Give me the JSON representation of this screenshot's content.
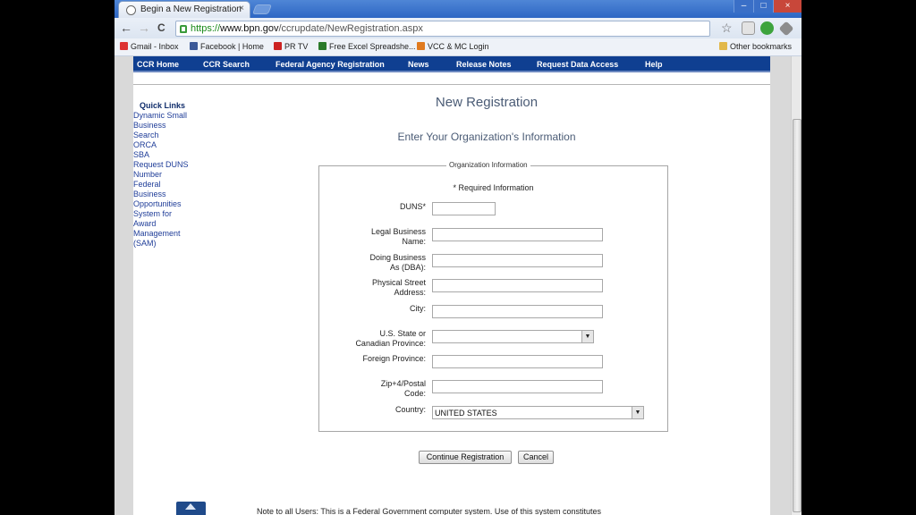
{
  "browser": {
    "tab_title": "Begin a New Registration",
    "tab_close": "×",
    "url_scheme": "https://",
    "url_host": "www.bpn.gov",
    "url_path": "/ccrupdate/NewRegistration.aspx",
    "star": "☆",
    "back": "←",
    "forward": "→",
    "reload": "C"
  },
  "bookmarks": {
    "items": [
      "Gmail - Inbox",
      "Facebook | Home",
      "PR TV",
      "Free Excel Spreadshe...",
      "VCC & MC Login"
    ],
    "other": "Other bookmarks"
  },
  "sitenav": {
    "items": [
      "CCR Home",
      "CCR Search",
      "Federal Agency Registration",
      "News",
      "Release Notes",
      "Request Data Access",
      "Help"
    ]
  },
  "quicklinks": {
    "title": "Quick Links",
    "items": [
      "Dynamic Small",
      "Business",
      "Search",
      "ORCA",
      "SBA",
      "Request DUNS",
      "Number",
      "Federal",
      "Business",
      "Opportunities",
      "System for",
      "Award",
      "Management",
      "(SAM)"
    ]
  },
  "main": {
    "title": "New Registration",
    "subtitle": "Enter Your Organization's Information"
  },
  "form": {
    "legend": "Organization Information",
    "required_note": "* Required Information",
    "duns_label": "DUNS*",
    "legal_name_label_1": "Legal Business",
    "legal_name_label_2": "Name:",
    "dba_label_1": "Doing Business",
    "dba_label_2": "As (DBA):",
    "street_label_1": "Physical Street",
    "street_label_2": "Address:",
    "city_label": "City:",
    "state_label_1": "U.S. State or",
    "state_label_2": "Canadian Province:",
    "state_value": "",
    "foreign_province_label": "Foreign Province:",
    "zip_label_1": "Zip+4/Postal",
    "zip_label_2": "Code:",
    "country_label": "Country:",
    "country_value": "UNITED STATES",
    "continue_button": "Continue Registration",
    "cancel_button": "Cancel"
  },
  "footer": {
    "note": "Note to all Users: This is a Federal Government computer system. Use of this system constitutes"
  },
  "colors": {
    "site_nav": "#0f3f91",
    "link": "#1f3d98",
    "heading": "#4a5b75"
  }
}
